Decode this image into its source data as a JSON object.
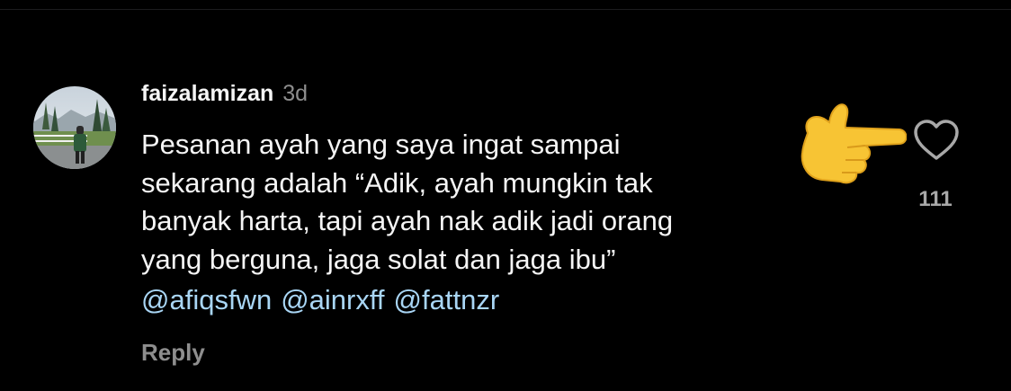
{
  "comment": {
    "username": "faizalamizan",
    "timestamp": "3d",
    "text": "Pesanan ayah yang saya ingat sampai\nsekarang adalah “Adik, ayah mungkin tak\nbanyak harta, tapi ayah nak adik jadi orang\nyang berguna, jaga solat dan jaga ibu”",
    "mentions": [
      "@afiqsfwn",
      "@ainrxff",
      "@fattnzr"
    ],
    "reply_label": "Reply",
    "like_count": "111"
  },
  "icons": {
    "like": "heart-outline-icon",
    "emoji": "backhand-index-pointing-right-emoji"
  },
  "colors": {
    "background": "#000000",
    "text_primary": "#f5f5f5",
    "text_secondary": "#8e8e8e",
    "mention": "#a9d6f5"
  }
}
